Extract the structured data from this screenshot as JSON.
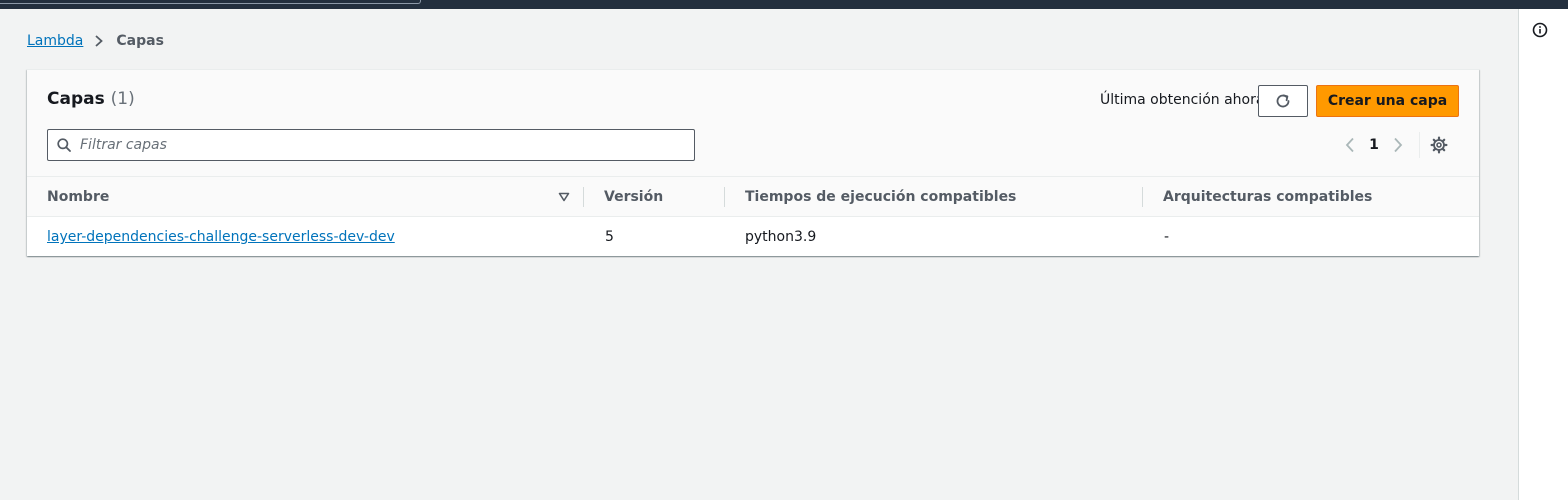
{
  "breadcrumb": {
    "root": "Lambda",
    "current": "Capas"
  },
  "panel": {
    "title": "Capas",
    "count": "(1)",
    "last_fetch": "Última obtención ahora",
    "create_label": "Crear una capa",
    "filter_placeholder": "Filtrar capas",
    "filter_value": "",
    "page_number": "1"
  },
  "table": {
    "columns": [
      "Nombre",
      "Versión",
      "Tiempos de ejecución compatibles",
      "Arquitecturas compatibles"
    ],
    "rows": [
      {
        "name": "layer-dependencies-challenge-serverless-dev-dev",
        "version": "5",
        "runtimes": "python3.9",
        "architectures": "-"
      }
    ]
  },
  "icons": {
    "info": "info-icon",
    "chevron": "chevron-right-icon",
    "refresh": "refresh-icon",
    "search": "search-icon",
    "prev": "chevron-left-icon",
    "next": "chevron-right-icon",
    "settings": "gear-icon",
    "sort": "sort-down-icon"
  },
  "colors": {
    "accent_orange": "#ff9900",
    "link_blue": "#0073bb",
    "top_nav": "#232f3e",
    "page_bg": "#f2f3f3"
  }
}
